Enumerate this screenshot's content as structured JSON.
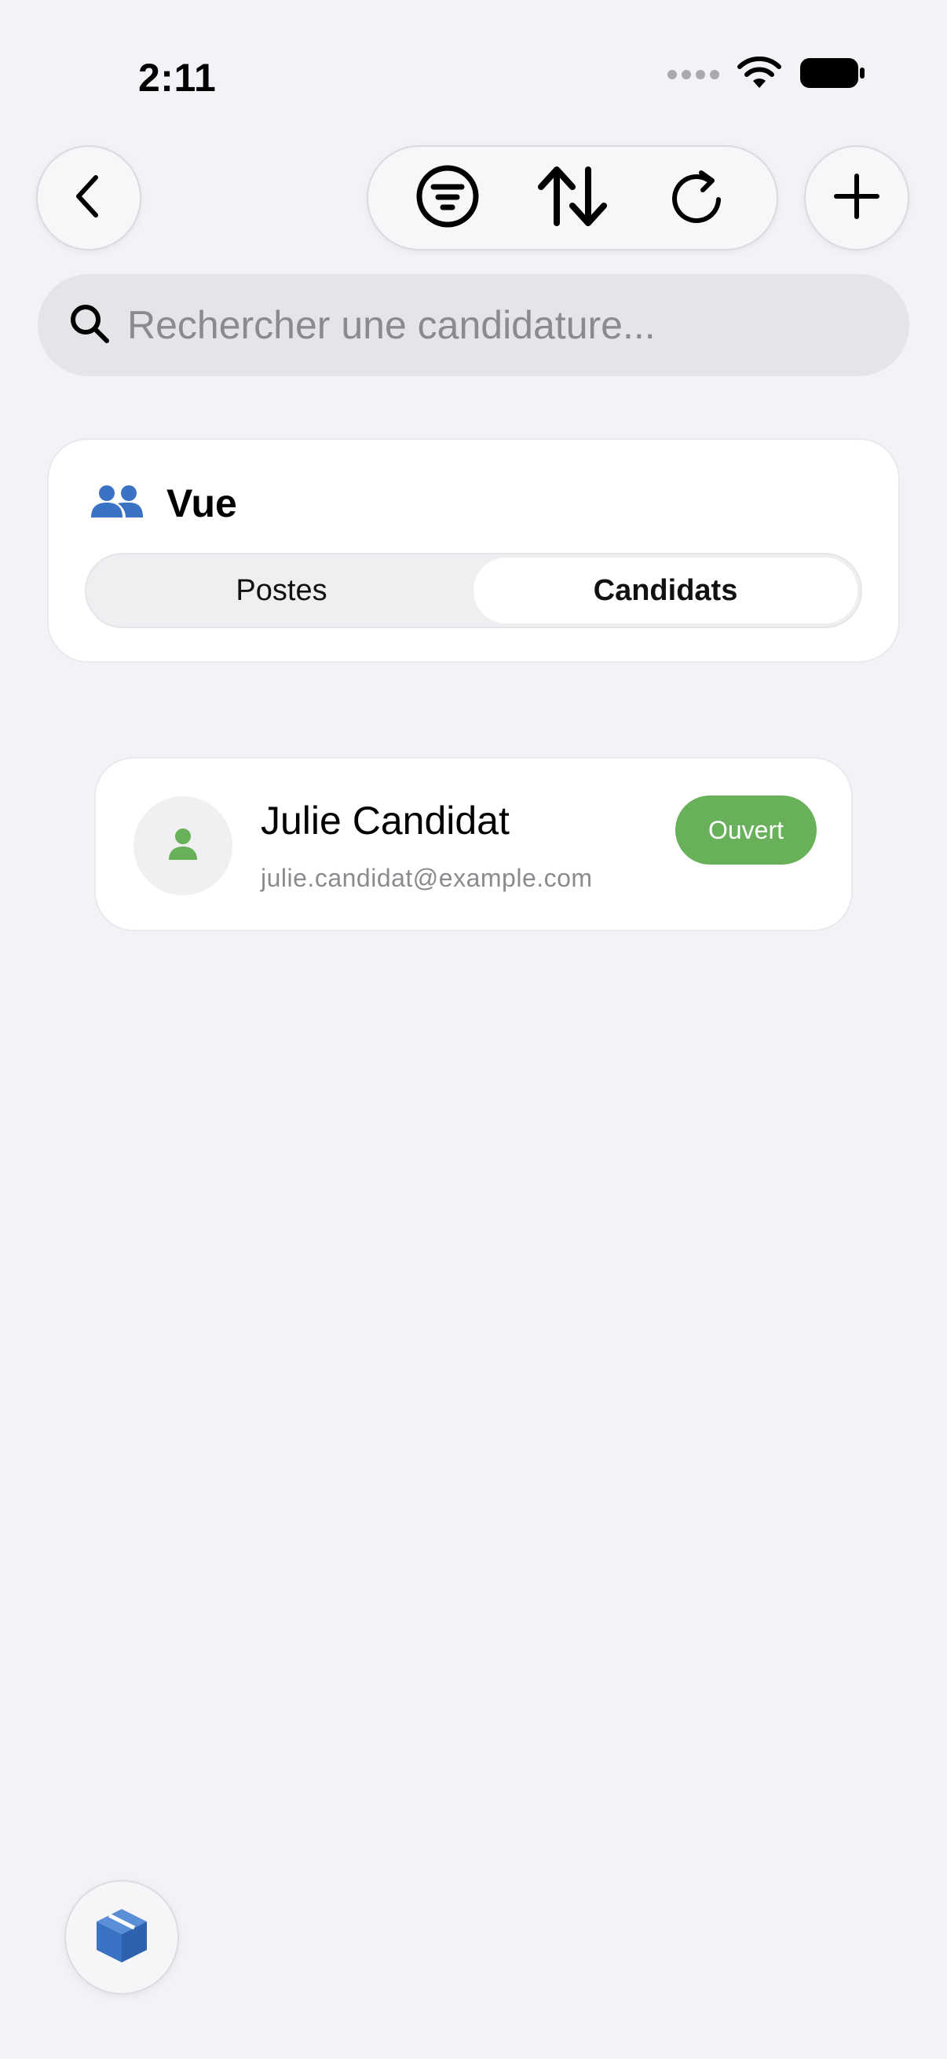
{
  "status_bar": {
    "time": "2:11",
    "icons": [
      "signal-dots-icon",
      "wifi-icon",
      "battery-icon"
    ]
  },
  "toolbar": {
    "back_icon": "chevron-left-icon",
    "filter_icon": "filter-lines-icon",
    "sort_icon": "sort-arrows-icon",
    "refresh_icon": "refresh-icon",
    "add_icon": "plus-icon"
  },
  "search": {
    "placeholder": "Rechercher une candidature...",
    "value": ""
  },
  "view": {
    "title": "Vue",
    "icon": "people-icon",
    "segments": [
      {
        "label": "Postes",
        "selected": false
      },
      {
        "label": "Candidats",
        "selected": true
      }
    ]
  },
  "candidates": [
    {
      "name": "Julie Candidat",
      "email": "julie.candidat@example.com",
      "status": "Ouvert",
      "status_color": "#68B05A",
      "avatar_icon": "person-icon"
    }
  ],
  "colors": {
    "accent_blue": "#3B73C4",
    "status_green": "#68B05A",
    "background": "#F2F2F7"
  },
  "floating_button": {
    "icon": "cube-icon"
  }
}
